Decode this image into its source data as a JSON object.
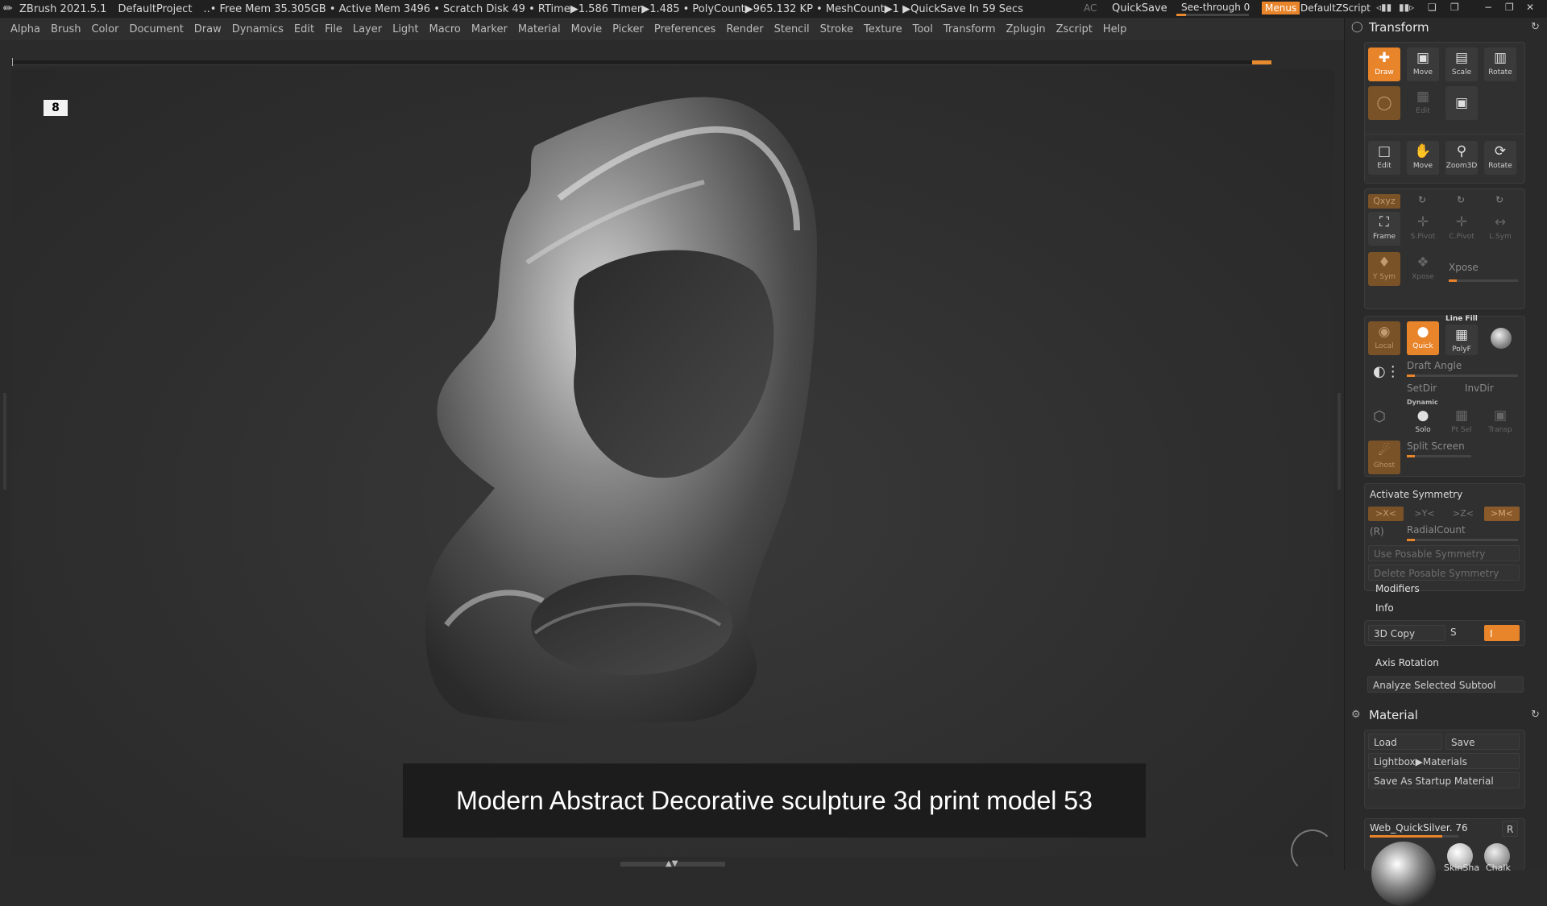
{
  "titlebar": {
    "app": "ZBrush 2021.5.1",
    "project": "DefaultProject",
    "status": "..• Free Mem 35.305GB • Active Mem 3496 • Scratch Disk 49 •  RTime▶1.586 Timer▶1.485 • PolyCount▶965.132 KP  • MeshCount▶1  ▶QuickSave In 59 Secs",
    "ac": "AC",
    "quicksave": "QuickSave",
    "see_through": "See-through  0",
    "see_through_value": 0,
    "menus": "Menus",
    "zscript": "DefaultZScript"
  },
  "menubar": [
    "Alpha",
    "Brush",
    "Color",
    "Document",
    "Draw",
    "Dynamics",
    "Edit",
    "File",
    "Layer",
    "Light",
    "Macro",
    "Marker",
    "Material",
    "Movie",
    "Picker",
    "Preferences",
    "Render",
    "Stencil",
    "Stroke",
    "Texture",
    "Tool",
    "Transform",
    "Zplugin",
    "Zscript",
    "Help"
  ],
  "viewport": {
    "corner_badge": "8",
    "caption": "Modern Abstract Decorative sculpture 3d print model 53"
  },
  "panel": {
    "transform": {
      "title": "Transform",
      "row1": [
        {
          "label": "Draw",
          "icon": "draw-icon",
          "state": "on"
        },
        {
          "label": "Move",
          "icon": "move-icon",
          "state": "normal"
        },
        {
          "label": "Scale",
          "icon": "scale-icon",
          "state": "normal"
        },
        {
          "label": "Rotate",
          "icon": "rotate-icon",
          "state": "normal"
        }
      ],
      "row2": [
        {
          "label": "",
          "icon": "sphere-icon",
          "state": "dim"
        },
        {
          "label": "Edit",
          "icon": "edit-icon",
          "state": "off"
        },
        {
          "label": "",
          "icon": "camera-icon",
          "state": "normal"
        }
      ],
      "nav": [
        {
          "label": "Edit",
          "icon": "edit-icon"
        },
        {
          "label": "Move",
          "icon": "hand-icon"
        },
        {
          "label": "Zoom3D",
          "icon": "zoom-icon"
        },
        {
          "label": "Rotate",
          "icon": "rotate-3d-icon"
        }
      ],
      "xyz_label": "Qxyz",
      "frame_row": [
        {
          "label": "Frame",
          "state": "normal"
        },
        {
          "label": "S.Pivot",
          "state": "off"
        },
        {
          "label": "C.Pivot",
          "state": "off"
        },
        {
          "label": "L.Sym",
          "state": "off"
        }
      ],
      "ysym_label": "Y Sym",
      "xpose_label": "Xpose",
      "xpose_btn": "Xpose",
      "display_row": [
        {
          "label": "Local",
          "state": "dim"
        },
        {
          "label": "Quick",
          "state": "on"
        },
        {
          "label": "PolyF",
          "state": "normal"
        },
        {
          "label": "",
          "state": "normal"
        }
      ],
      "line_fill": "Line Fill",
      "draft_angle": "Draft Angle",
      "setdir": "SetDir",
      "invdir": "InvDir",
      "dynamic": "Dynamic",
      "solo": "Solo",
      "ptsel": "Pt Sel",
      "transp": "Transp",
      "split_screen": "Split Screen",
      "ghost": "Ghost",
      "activate_symmetry": "Activate Symmetry",
      "axes": [
        ">X<",
        ">Y<",
        ">Z<",
        ">M<"
      ],
      "r_label": "(R)",
      "radial_count": "RadialCount",
      "use_posable": "Use Posable Symmetry",
      "delete_posable": "Delete Posable Symmetry",
      "modifiers": "Modifiers",
      "info": "Info",
      "copy3d": "3D Copy",
      "s_label": "S",
      "i_label": "I",
      "axis_rotation": "Axis Rotation",
      "analyze": "Analyze Selected Subtool"
    },
    "material": {
      "title": "Material",
      "load": "Load",
      "save": "Save",
      "lightbox": "Lightbox▶Materials",
      "save_startup": "Save As Startup Material",
      "current": "Web_QuickSilver. 76",
      "r_btn": "R",
      "swatches": [
        "SkinSha",
        "Chalk"
      ]
    }
  },
  "colors": {
    "accent": "#e8842a",
    "bg": "#2b2b2b",
    "panel": "#2a2a2a"
  }
}
